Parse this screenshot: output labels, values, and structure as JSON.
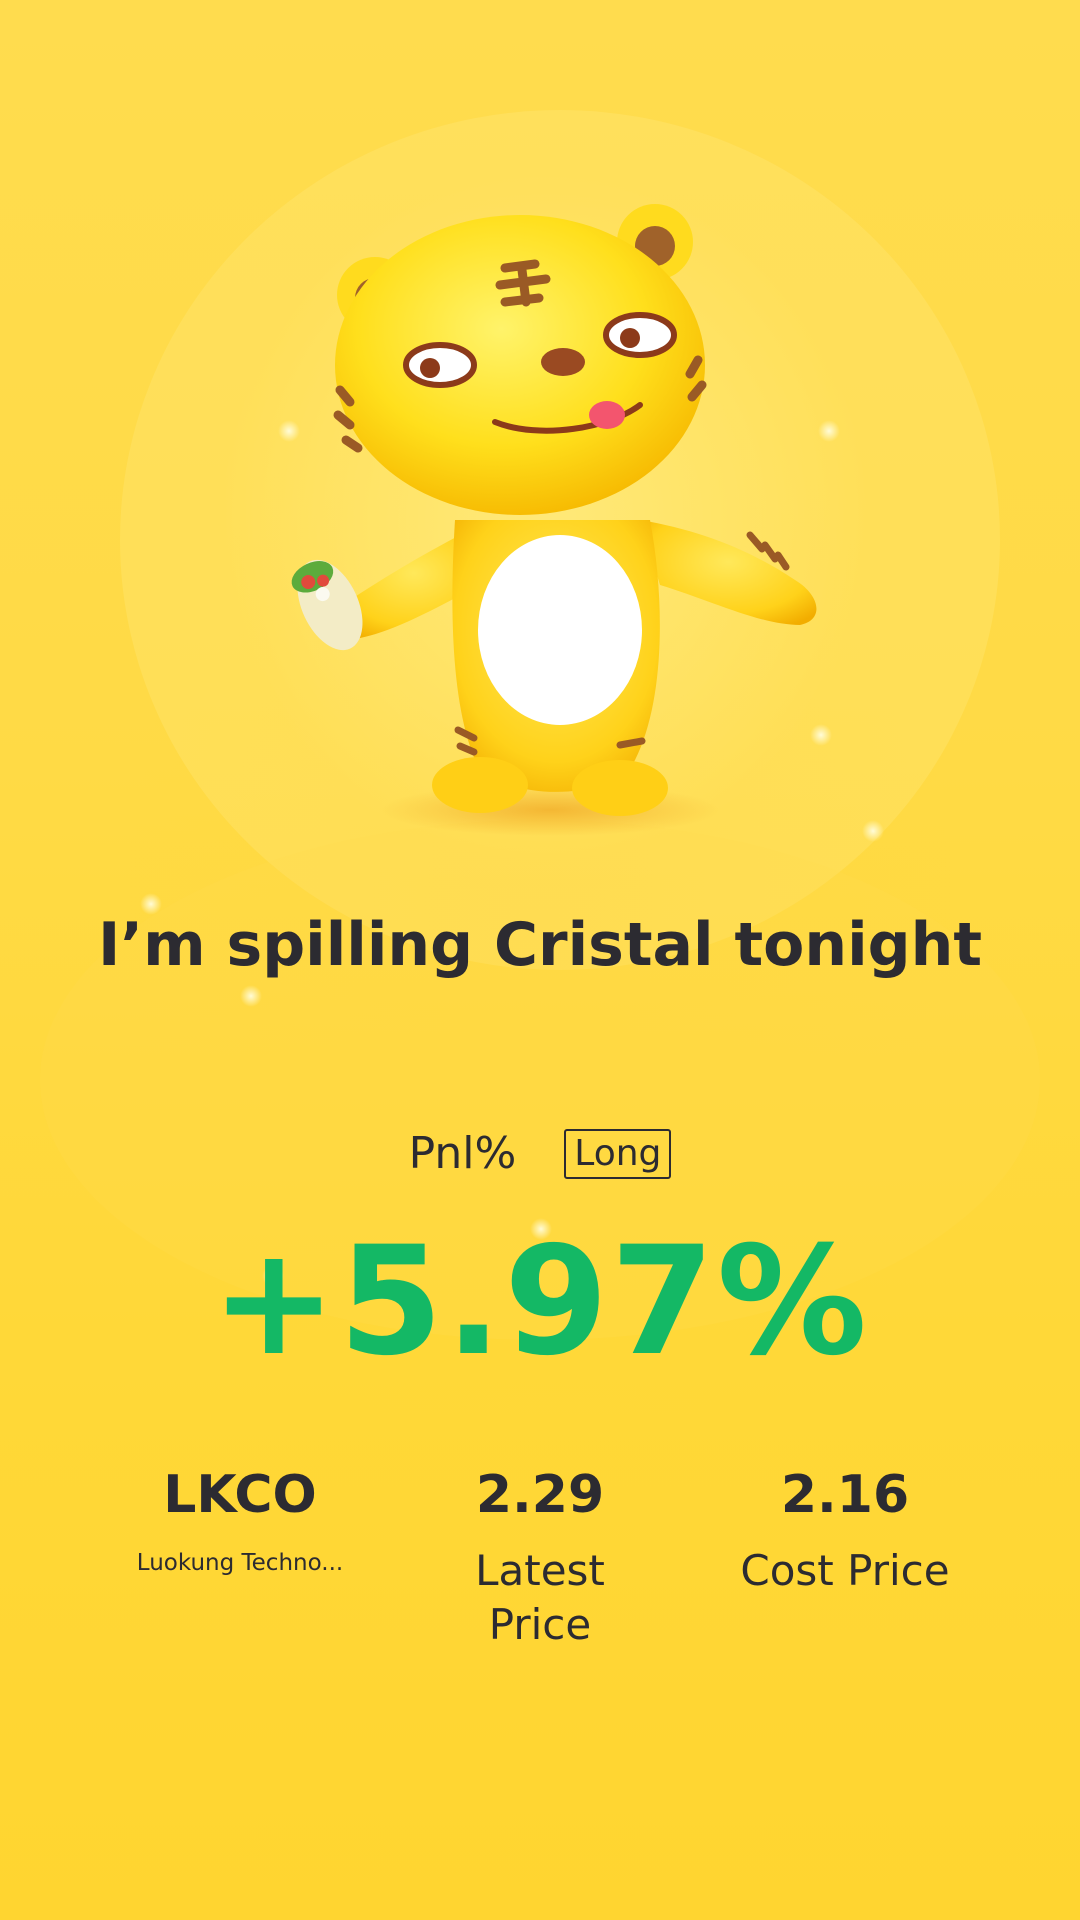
{
  "card": {
    "headline": "I’m spilling Cristal tonight",
    "pnl_label": "Pnl%",
    "position_side": "Long",
    "pnl_value": "+5.97%"
  },
  "stats": {
    "symbol": "LKCO",
    "company_name": "Luokung Techno...",
    "latest_price": "2.29",
    "latest_price_label": "Latest Price",
    "cost_price": "2.16",
    "cost_price_label": "Cost Price"
  },
  "mascot": {
    "icon": "tiger-mascot-icon"
  },
  "colors": {
    "background": "#ffd93f",
    "gain": "#14b865",
    "text": "#2c2b31",
    "mascot_body": "#ffd21a",
    "mascot_belly": "#ffffff",
    "mascot_stripes": "#9a5a25"
  }
}
